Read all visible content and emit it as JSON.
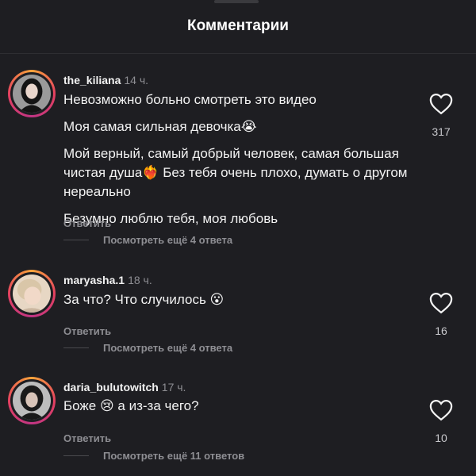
{
  "header": {
    "title": "Комментарии"
  },
  "comments": [
    {
      "username": "the_kiliana",
      "time": "14 ч.",
      "lines": [
        "Невозможно больно смотреть это видео",
        "Моя самая сильная девочка😭",
        "Мой верный, самый добрый человек, самая большая чистая душа❤️‍🔥 Без тебя очень плохо, думать о другом нереально",
        "Безумно люблю тебя, моя любовь"
      ],
      "reply_label": "Ответить",
      "more_replies": "Посмотреть ещё 4 ответа",
      "likes": "317",
      "icon": "heart-outline-icon"
    },
    {
      "username": "maryasha.1",
      "time": "18 ч.",
      "lines": [
        "За что? Что случилось 😮"
      ],
      "reply_label": "Ответить",
      "more_replies": "Посмотреть ещё 4 ответа",
      "likes": "16",
      "icon": "heart-outline-icon"
    },
    {
      "username": "daria_bulutowitch",
      "time": "17 ч.",
      "lines": [
        "Боже 😢 а из-за чего?"
      ],
      "reply_label": "Ответить",
      "more_replies": "Посмотреть ещё 11 ответов",
      "likes": "10",
      "icon": "heart-outline-icon"
    }
  ],
  "colors": {
    "background": "#1e1e22",
    "text_primary": "#f2f2f2",
    "text_secondary": "#8e8e93",
    "story_ring": "#e4405f"
  }
}
